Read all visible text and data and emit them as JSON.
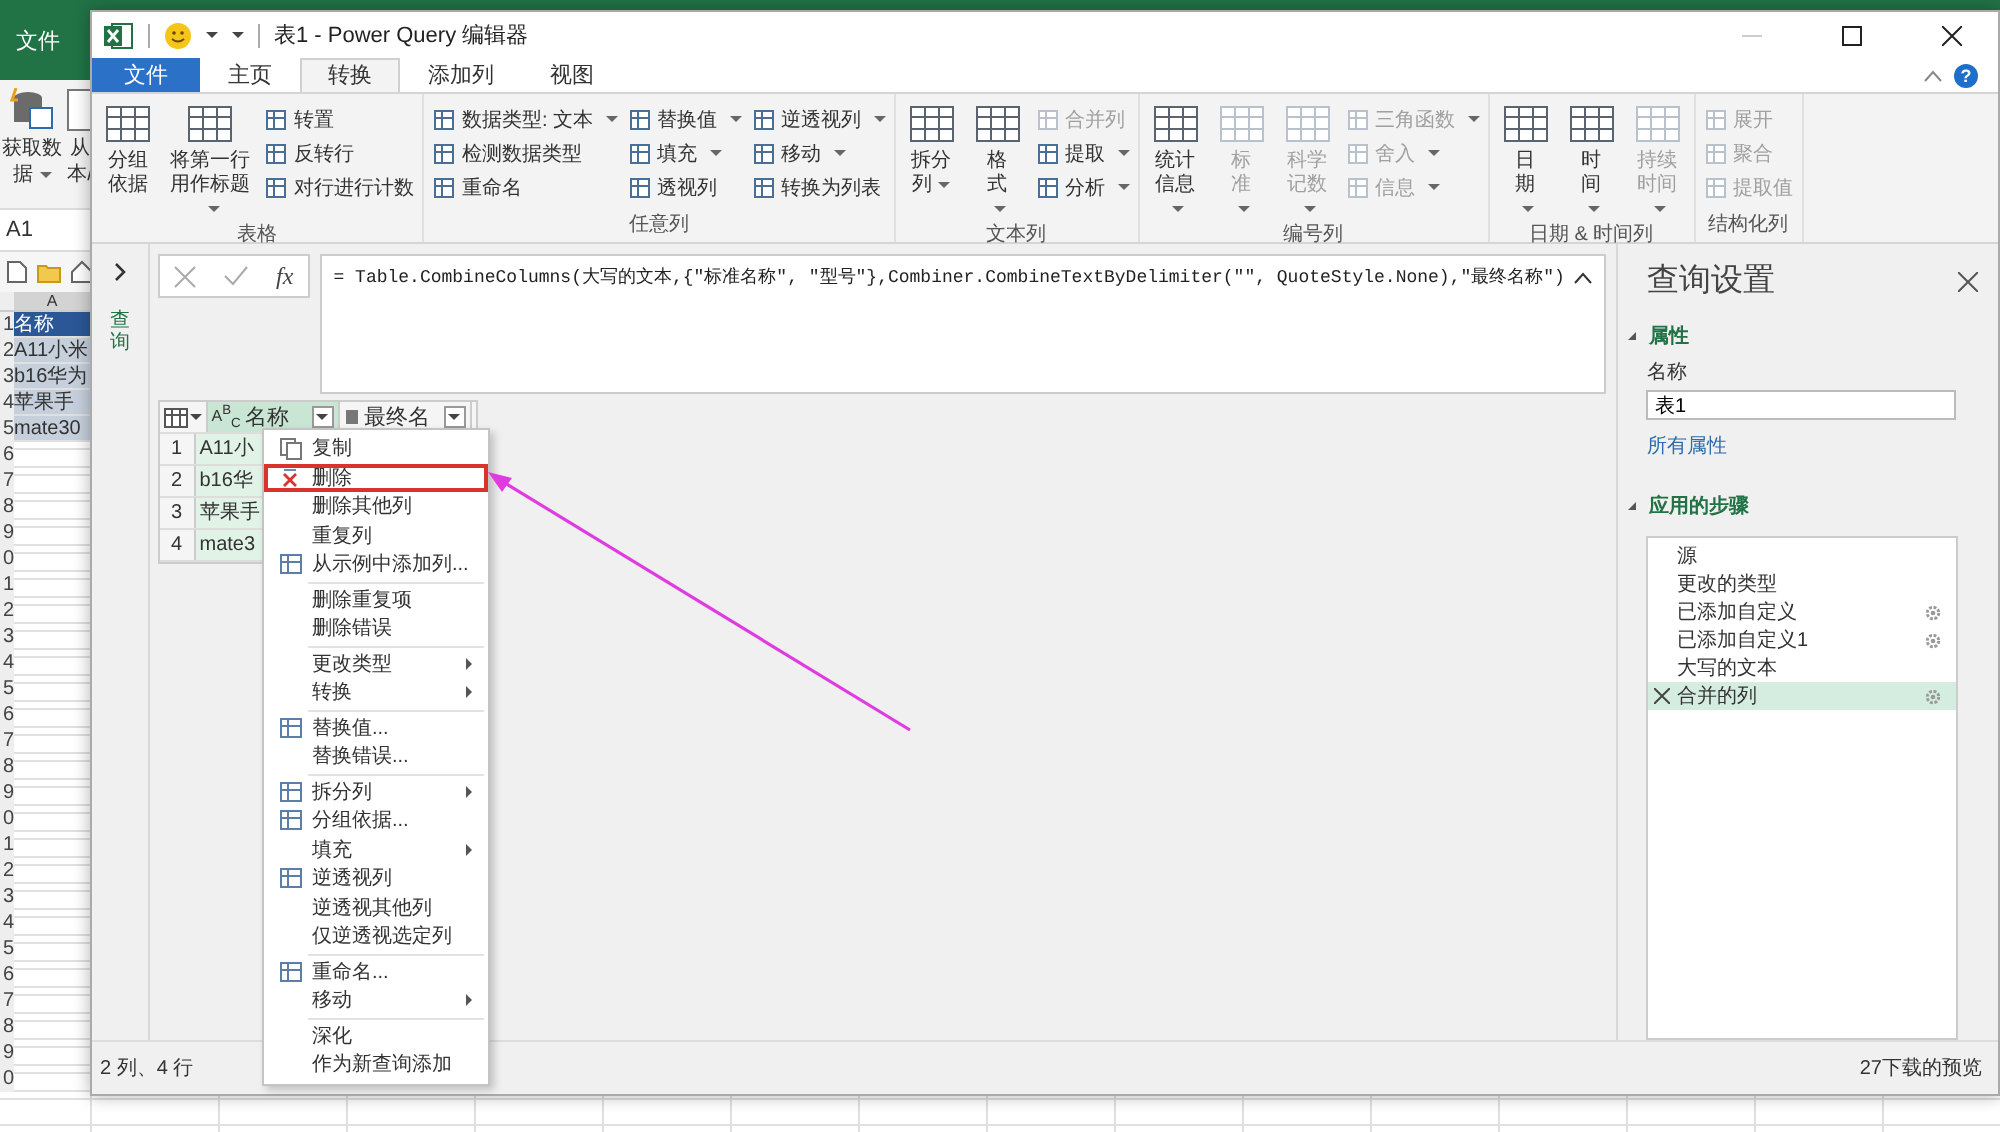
{
  "excel": {
    "file_tab": "文件",
    "ribbon": [
      {
        "label": "获取数据",
        "dropdown": true
      },
      {
        "label": "从本/",
        "dropdown": false
      }
    ],
    "name_box": "A1",
    "column": "A",
    "rows": [
      {
        "num": "1",
        "value": "名称",
        "kind": "header",
        "selected": true
      },
      {
        "num": "2",
        "value": "A11小米",
        "kind": "data",
        "selected": true
      },
      {
        "num": "3",
        "value": "b16华为",
        "kind": "data",
        "selected": true
      },
      {
        "num": "4",
        "value": "苹果手",
        "kind": "data",
        "selected": true
      },
      {
        "num": "5",
        "value": "mate30",
        "kind": "data",
        "selected": true
      },
      {
        "num": "6"
      },
      {
        "num": "7"
      },
      {
        "num": "8"
      },
      {
        "num": "9"
      },
      {
        "num": "0"
      },
      {
        "num": "1"
      },
      {
        "num": "2"
      },
      {
        "num": "3"
      },
      {
        "num": "4"
      },
      {
        "num": "5"
      },
      {
        "num": "6"
      },
      {
        "num": "7"
      },
      {
        "num": "8"
      },
      {
        "num": "9"
      },
      {
        "num": "0"
      },
      {
        "num": "1"
      },
      {
        "num": "2"
      },
      {
        "num": "3"
      },
      {
        "num": "4"
      },
      {
        "num": "5"
      },
      {
        "num": "6"
      },
      {
        "num": "7"
      },
      {
        "num": "8"
      },
      {
        "num": "9"
      },
      {
        "num": "0"
      }
    ]
  },
  "window": {
    "title": "表1 - Power Query 编辑器",
    "help": "?"
  },
  "tabs": [
    {
      "label": "文件",
      "kind": "file",
      "selected": false
    },
    {
      "label": "主页",
      "kind": "tab",
      "selected": false
    },
    {
      "label": "转换",
      "kind": "tab",
      "selected": true
    },
    {
      "label": "添加列",
      "kind": "tab",
      "selected": false
    },
    {
      "label": "视图",
      "kind": "tab",
      "selected": false
    }
  ],
  "ribbon": {
    "groups": [
      {
        "label": "表格",
        "items": [
          {
            "kind": "large",
            "label": "分组依据",
            "dropdown": false,
            "disabled": false
          },
          {
            "kind": "large",
            "label": "将第一行用作标题",
            "dropdown": true,
            "disabled": false
          },
          {
            "kind": "stack",
            "items": [
              {
                "label": "转置",
                "dropdown": false,
                "disabled": false
              },
              {
                "label": "反转行",
                "dropdown": false,
                "disabled": false
              },
              {
                "label": "对行进行计数",
                "dropdown": false,
                "disabled": false
              }
            ]
          }
        ]
      },
      {
        "label": "任意列",
        "items": [
          {
            "kind": "stack",
            "items": [
              {
                "label": "数据类型: 文本",
                "dropdown": true,
                "disabled": false
              },
              {
                "label": "检测数据类型",
                "dropdown": false,
                "disabled": false
              },
              {
                "label": "重命名",
                "dropdown": false,
                "disabled": false
              }
            ]
          },
          {
            "kind": "stack",
            "items": [
              {
                "label": "替换值",
                "dropdown": true,
                "disabled": false
              },
              {
                "label": "填充",
                "dropdown": true,
                "disabled": false
              },
              {
                "label": "透视列",
                "dropdown": false,
                "disabled": false
              }
            ]
          },
          {
            "kind": "stack",
            "items": [
              {
                "label": "逆透视列",
                "dropdown": true,
                "disabled": false
              },
              {
                "label": "移动",
                "dropdown": true,
                "disabled": false
              },
              {
                "label": "转换为列表",
                "dropdown": false,
                "disabled": false
              }
            ]
          }
        ]
      },
      {
        "label": "文本列",
        "items": [
          {
            "kind": "large",
            "label": "拆分列",
            "dropdown": true,
            "disabled": false
          },
          {
            "kind": "large",
            "label": "格式",
            "dropdown": true,
            "disabled": false
          },
          {
            "kind": "stack",
            "items": [
              {
                "label": "合并列",
                "dropdown": false,
                "disabled": true
              },
              {
                "label": "提取",
                "dropdown": true,
                "disabled": false
              },
              {
                "label": "分析",
                "dropdown": true,
                "disabled": false
              }
            ]
          }
        ]
      },
      {
        "label": "编号列",
        "items": [
          {
            "kind": "large",
            "label": "统计信息",
            "dropdown": true,
            "disabled": false
          },
          {
            "kind": "large",
            "label": "标准",
            "dropdown": true,
            "disabled": true
          },
          {
            "kind": "large",
            "label": "科学记数",
            "dropdown": true,
            "disabled": true
          },
          {
            "kind": "stack",
            "items": [
              {
                "label": "三角函数",
                "dropdown": true,
                "disabled": true
              },
              {
                "label": "舍入",
                "dropdown": true,
                "disabled": true
              },
              {
                "label": "信息",
                "dropdown": true,
                "disabled": true
              }
            ]
          }
        ]
      },
      {
        "label": "日期 & 时间列",
        "items": [
          {
            "kind": "large",
            "label": "日期",
            "dropdown": true,
            "disabled": false
          },
          {
            "kind": "large",
            "label": "时间",
            "dropdown": true,
            "disabled": false
          },
          {
            "kind": "large",
            "label": "持续时间",
            "dropdown": true,
            "disabled": true
          }
        ]
      },
      {
        "label": "结构化列",
        "items": [
          {
            "kind": "stack",
            "items": [
              {
                "label": "展开",
                "dropdown": false,
                "disabled": true
              },
              {
                "label": "聚合",
                "dropdown": false,
                "disabled": true
              },
              {
                "label": "提取值",
                "dropdown": false,
                "disabled": true
              }
            ]
          }
        ]
      }
    ]
  },
  "queries_pane": {
    "label": "查询"
  },
  "formula_bar": {
    "fx": "fx",
    "formula": "= Table.CombineColumns(大写的文本,{\"标准名称\", \"型号\"},Combiner.CombineTextByDelimiter(\"\", QuoteStyle.None),\"最终名称\")"
  },
  "table": {
    "columns": [
      {
        "type_label": "A$^{B}$$_{C}$",
        "name": "名称",
        "selected": true
      },
      {
        "name": "最终名",
        "selected": false
      }
    ],
    "rows": [
      {
        "num": "1",
        "value": "A11小"
      },
      {
        "num": "2",
        "value": "b16华"
      },
      {
        "num": "3",
        "value": "苹果手"
      },
      {
        "num": "4",
        "value": "mate3"
      }
    ]
  },
  "context_menu": {
    "groups": [
      [
        {
          "label": "复制",
          "submenu": false,
          "highlighted": false
        },
        {
          "label": "删除",
          "submenu": false,
          "highlighted": true
        },
        {
          "label": "删除其他列",
          "submenu": false,
          "highlighted": false
        },
        {
          "label": "重复列",
          "submenu": false,
          "highlighted": false
        },
        {
          "label": "从示例中添加列...",
          "submenu": false,
          "highlighted": false
        }
      ],
      [
        {
          "label": "删除重复项",
          "submenu": false,
          "highlighted": false
        },
        {
          "label": "删除错误",
          "submenu": false,
          "highlighted": false
        }
      ],
      [
        {
          "label": "更改类型",
          "submenu": true,
          "highlighted": false
        },
        {
          "label": "转换",
          "submenu": true,
          "highlighted": false
        }
      ],
      [
        {
          "label": "替换值...",
          "submenu": false,
          "highlighted": false
        },
        {
          "label": "替换错误...",
          "submenu": false,
          "highlighted": false
        }
      ],
      [
        {
          "label": "拆分列",
          "submenu": true,
          "highlighted": false
        },
        {
          "label": "分组依据...",
          "submenu": false,
          "highlighted": false
        },
        {
          "label": "填充",
          "submenu": true,
          "highlighted": false
        },
        {
          "label": "逆透视列",
          "submenu": false,
          "highlighted": false
        },
        {
          "label": "逆透视其他列",
          "submenu": false,
          "highlighted": false
        },
        {
          "label": "仅逆透视选定列",
          "submenu": false,
          "highlighted": false
        }
      ],
      [
        {
          "label": "重命名...",
          "submenu": false,
          "highlighted": false
        },
        {
          "label": "移动",
          "submenu": true,
          "highlighted": false
        }
      ],
      [
        {
          "label": "深化",
          "submenu": false,
          "highlighted": false
        },
        {
          "label": "作为新查询添加",
          "submenu": false,
          "highlighted": false
        }
      ]
    ]
  },
  "settings": {
    "title": "查询设置",
    "properties_heading": "属性",
    "name_label": "名称",
    "name_value": "表1",
    "all_properties": "所有属性",
    "steps_heading": "应用的步骤",
    "steps": [
      {
        "label": "源",
        "has_settings": false,
        "selected": false
      },
      {
        "label": "更改的类型",
        "has_settings": false,
        "selected": false
      },
      {
        "label": "已添加自定义",
        "has_settings": true,
        "selected": false
      },
      {
        "label": "已添加自定义1",
        "has_settings": true,
        "selected": false
      },
      {
        "label": "大写的文本",
        "has_settings": false,
        "selected": false
      },
      {
        "label": "合并的列",
        "has_settings": true,
        "selected": true
      }
    ]
  },
  "status_bar": {
    "left": "2 列、4 行",
    "right": "27下载的预览"
  }
}
